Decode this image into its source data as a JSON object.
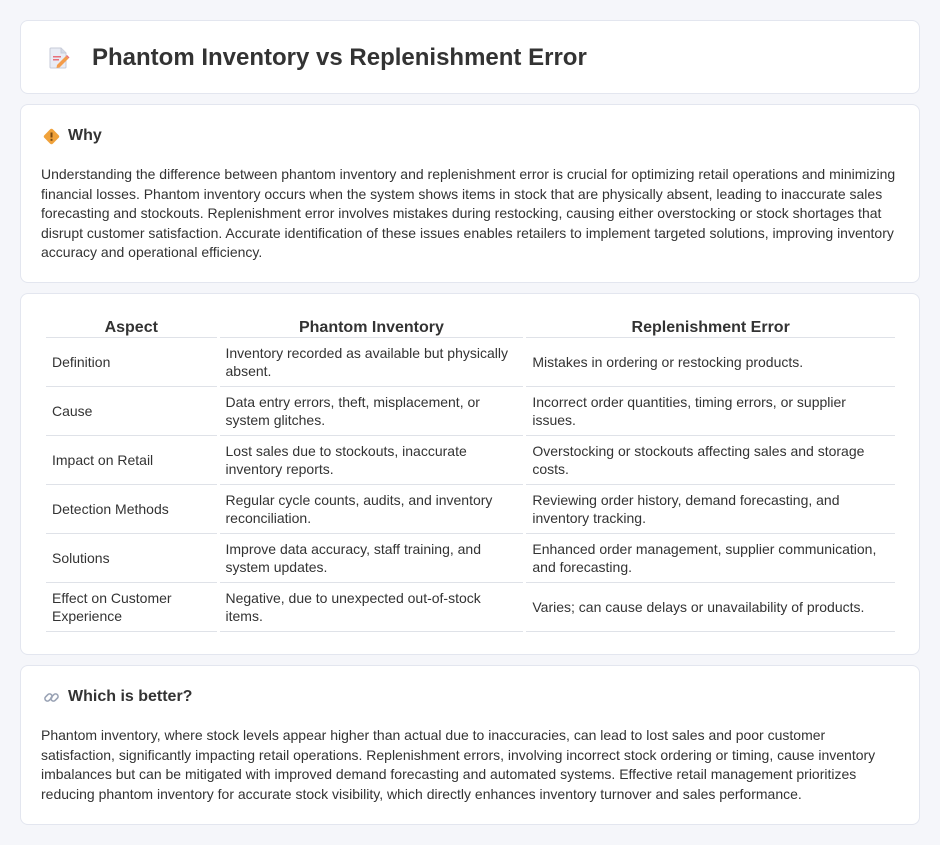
{
  "header": {
    "title": "Phantom Inventory vs Replenishment Error",
    "icon": "document-pencil-icon"
  },
  "why": {
    "heading": "Why",
    "icon": "diamond-sign-icon",
    "body": "Understanding the difference between phantom inventory and replenishment error is crucial for optimizing retail operations and minimizing financial losses. Phantom inventory occurs when the system shows items in stock that are physically absent, leading to inaccurate sales forecasting and stockouts. Replenishment error involves mistakes during restocking, causing either overstocking or stock shortages that disrupt customer satisfaction. Accurate identification of these issues enables retailers to implement targeted solutions, improving inventory accuracy and operational efficiency."
  },
  "comparison": {
    "headers": [
      "Aspect",
      "Phantom Inventory",
      "Replenishment Error"
    ],
    "rows": [
      [
        "Definition",
        "Inventory recorded as available but physically absent.",
        "Mistakes in ordering or restocking products."
      ],
      [
        "Cause",
        "Data entry errors, theft, misplacement, or system glitches.",
        "Incorrect order quantities, timing errors, or supplier issues."
      ],
      [
        "Impact on Retail",
        "Lost sales due to stockouts, inaccurate inventory reports.",
        "Overstocking or stockouts affecting sales and storage costs."
      ],
      [
        "Detection Methods",
        "Regular cycle counts, audits, and inventory reconciliation.",
        "Reviewing order history, demand forecasting, and inventory tracking."
      ],
      [
        "Solutions",
        "Improve data accuracy, staff training, and system updates.",
        "Enhanced order management, supplier communication, and forecasting."
      ],
      [
        "Effect on Customer Experience",
        "Negative, due to unexpected out-of-stock items.",
        "Varies; can cause delays or unavailability of products."
      ]
    ]
  },
  "better": {
    "heading": "Which is better?",
    "icon": "link-icon",
    "body": "Phantom inventory, where stock levels appear higher than actual due to inaccuracies, can lead to lost sales and poor customer satisfaction, significantly impacting retail operations. Replenishment errors, involving incorrect stock ordering or timing, cause inventory imbalances but can be mitigated with improved demand forecasting and automated systems. Effective retail management prioritizes reducing phantom inventory for accurate stock visibility, which directly enhances inventory turnover and sales performance."
  },
  "colors": {
    "background": "#f5f6fa",
    "card": "#ffffff",
    "border": "#e3e6ef",
    "text": "#333333",
    "accent_orange": "#f0a23b"
  }
}
